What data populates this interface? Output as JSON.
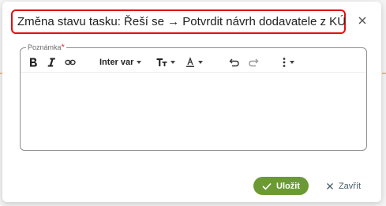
{
  "dialog": {
    "title": "Změna stavu tasku: Řeší se → Potvrdit návrh dodavatele z KÚ",
    "close_icon": "close-icon"
  },
  "note": {
    "label": "Poznámka",
    "required_mark": "*",
    "value": ""
  },
  "toolbar": {
    "bold_icon": "bold-icon",
    "italic_icon": "italic-icon",
    "link_icon": "link-icon",
    "font_family": "Inter var",
    "font_size_icon": "font-size-icon",
    "text_color_label": "A",
    "undo_icon": "undo-icon",
    "redo_icon": "redo-icon",
    "more_icon": "more-vertical-icon"
  },
  "actions": {
    "save_label": "Uložit",
    "close_label": "Zavřít"
  },
  "colors": {
    "accent_save": "#6b9a34",
    "title_border": "#e01010",
    "required": "#d32f2f"
  }
}
